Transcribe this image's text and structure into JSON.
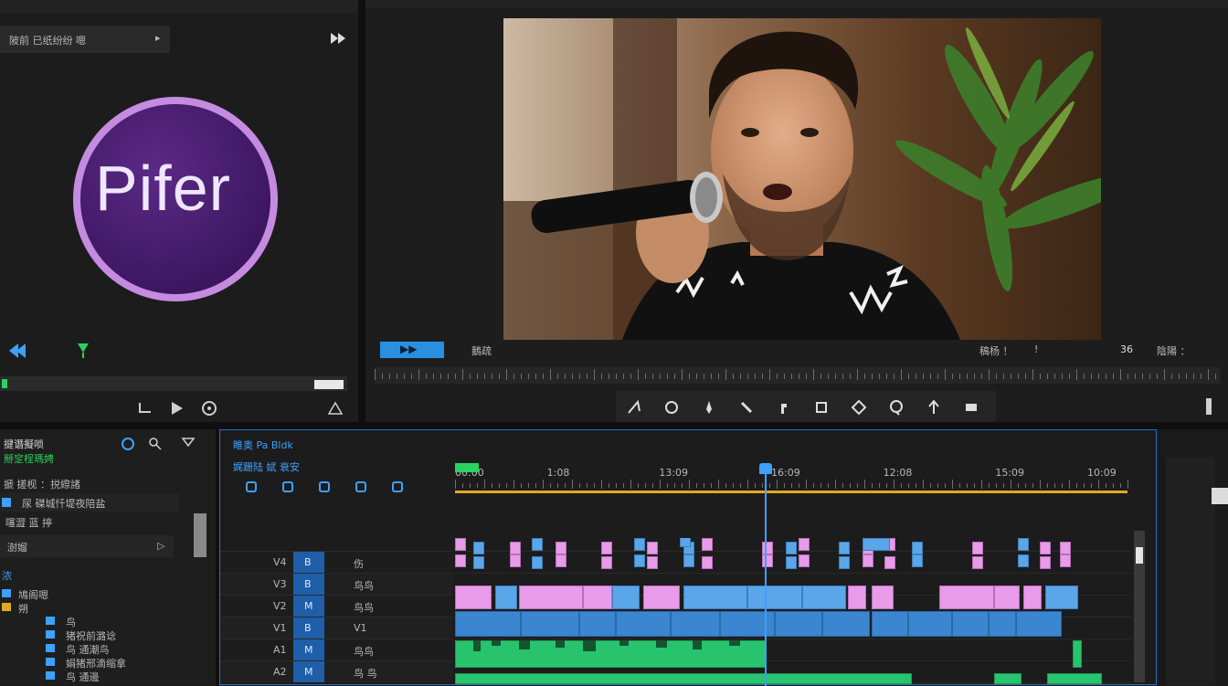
{
  "source_panel": {
    "header_label": "陂前 已纸纷纷 嗯",
    "header_arrow": "▸",
    "header_end_icon": "fast-forward-icon",
    "logo_text": "Pifer",
    "logo_colors": {
      "ring": "#c48be0",
      "fill": "#4a1f6e",
      "text": "#efe6ff"
    },
    "footer_icons": [
      "rewind-icon",
      "marker-icon",
      "step-icon",
      "play-icon",
      "camera-icon",
      "export-icon"
    ]
  },
  "program_monitor": {
    "left_badge": "▶▶",
    "left_label": "鵝疏",
    "right_label_1": "稿杨 ！",
    "right_label_2": "!",
    "right_label_3": "36",
    "right_label_4": "陰陽 ：",
    "tool_icons": [
      "razor-icon",
      "ripple-icon",
      "pen-icon",
      "slip-icon",
      "hand-icon",
      "rect-icon",
      "diamond-icon",
      "lasso-icon",
      "pointer-icon",
      "text-icon"
    ],
    "end_icon": "bar-icon"
  },
  "project_panel": {
    "title": "揵谮擬唢",
    "subtitle": "掰窆桯瑪娉",
    "row1": "搋 搓枧 ：捝縩諸",
    "row2": "尿 磔城忏堤夜陪盐",
    "row3": "噻澀 蓝 揨",
    "dropdown_value": "澍媹",
    "dropdown_arrow": "▷",
    "section_label": "浓",
    "items": [
      {
        "icon": "clip-icon",
        "label": "鳩阁嗯"
      },
      {
        "icon": "folder-icon",
        "label": "朔"
      },
      {
        "icon": "bin-icon",
        "label": "鸟"
      },
      {
        "icon": "seq-icon",
        "label": "猪祝前潞谂"
      },
      {
        "icon": "audio-icon",
        "label": "鸟 通潮鸟"
      },
      {
        "icon": "video-icon",
        "label": "娟猪邢滴缩拿"
      },
      {
        "icon": "other-icon",
        "label": "鸟 通邊"
      }
    ]
  },
  "timeline": {
    "title": "睢奥 Pa Bldk",
    "subtitle": "娓跚陆 娬 衰安",
    "timecodes": [
      "00:00",
      "1:08",
      "13:09",
      "16:09",
      "12:08",
      "15:09",
      "10:09"
    ],
    "track_labels": [
      {
        "a": "V4",
        "b": "B",
        "c": "伤"
      },
      {
        "a": "V3",
        "b": "B",
        "c": "鸟鸟"
      },
      {
        "a": "V2",
        "b": "M",
        "c": "鸟鸟"
      },
      {
        "a": "V1",
        "b": "B",
        "c": "V1"
      },
      {
        "a": "A1",
        "b": "M",
        "c": "鸟鸟"
      },
      {
        "a": "A2",
        "b": "M",
        "c": "鸟 鸟"
      }
    ],
    "colors": {
      "playhead": "#3ea0ff",
      "work_area": "#e2a81f",
      "clip_pink": "#e79be9",
      "clip_blue": "#5aa6e8",
      "clip_green": "#28c46d"
    }
  }
}
